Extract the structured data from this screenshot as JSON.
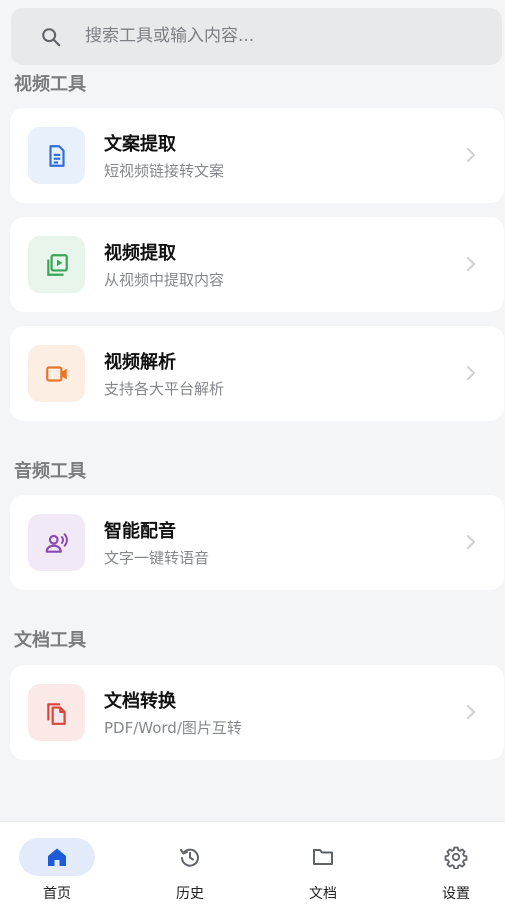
{
  "search": {
    "placeholder": "搜索工具或输入内容..."
  },
  "sections": [
    {
      "title": "视频工具",
      "items": [
        {
          "title": "文案提取",
          "subtitle": "短视频链接转文案",
          "icon": "document-icon",
          "color": "#2f6fdb",
          "bg": "#e8f0fc"
        },
        {
          "title": "视频提取",
          "subtitle": "从视频中提取内容",
          "icon": "video-library-icon",
          "color": "#3aa457",
          "bg": "#e7f5ea"
        },
        {
          "title": "视频解析",
          "subtitle": "支持各大平台解析",
          "icon": "video-camera-icon",
          "color": "#e8752a",
          "bg": "#fdeee3"
        }
      ]
    },
    {
      "title": "音频工具",
      "items": [
        {
          "title": "智能配音",
          "subtitle": "文字一键转语音",
          "icon": "voice-person-icon",
          "color": "#8a4ab1",
          "bg": "#f1e9f6"
        }
      ]
    },
    {
      "title": "文档工具",
      "items": [
        {
          "title": "文档转换",
          "subtitle": "PDF/Word/图片互转",
          "icon": "file-copy-icon",
          "color": "#d9443a",
          "bg": "#fbe9e7"
        }
      ]
    }
  ],
  "nav": [
    {
      "label": "首页",
      "icon": "home-icon",
      "active": true
    },
    {
      "label": "历史",
      "icon": "history-icon",
      "active": false
    },
    {
      "label": "文档",
      "icon": "folder-icon",
      "active": false
    },
    {
      "label": "设置",
      "icon": "gear-icon",
      "active": false
    }
  ],
  "colors": {
    "accent": "#1e5bd8",
    "activePill": "#e3ebfb",
    "navIcon": "#5f6368",
    "chevron": "#cfd1d4"
  }
}
